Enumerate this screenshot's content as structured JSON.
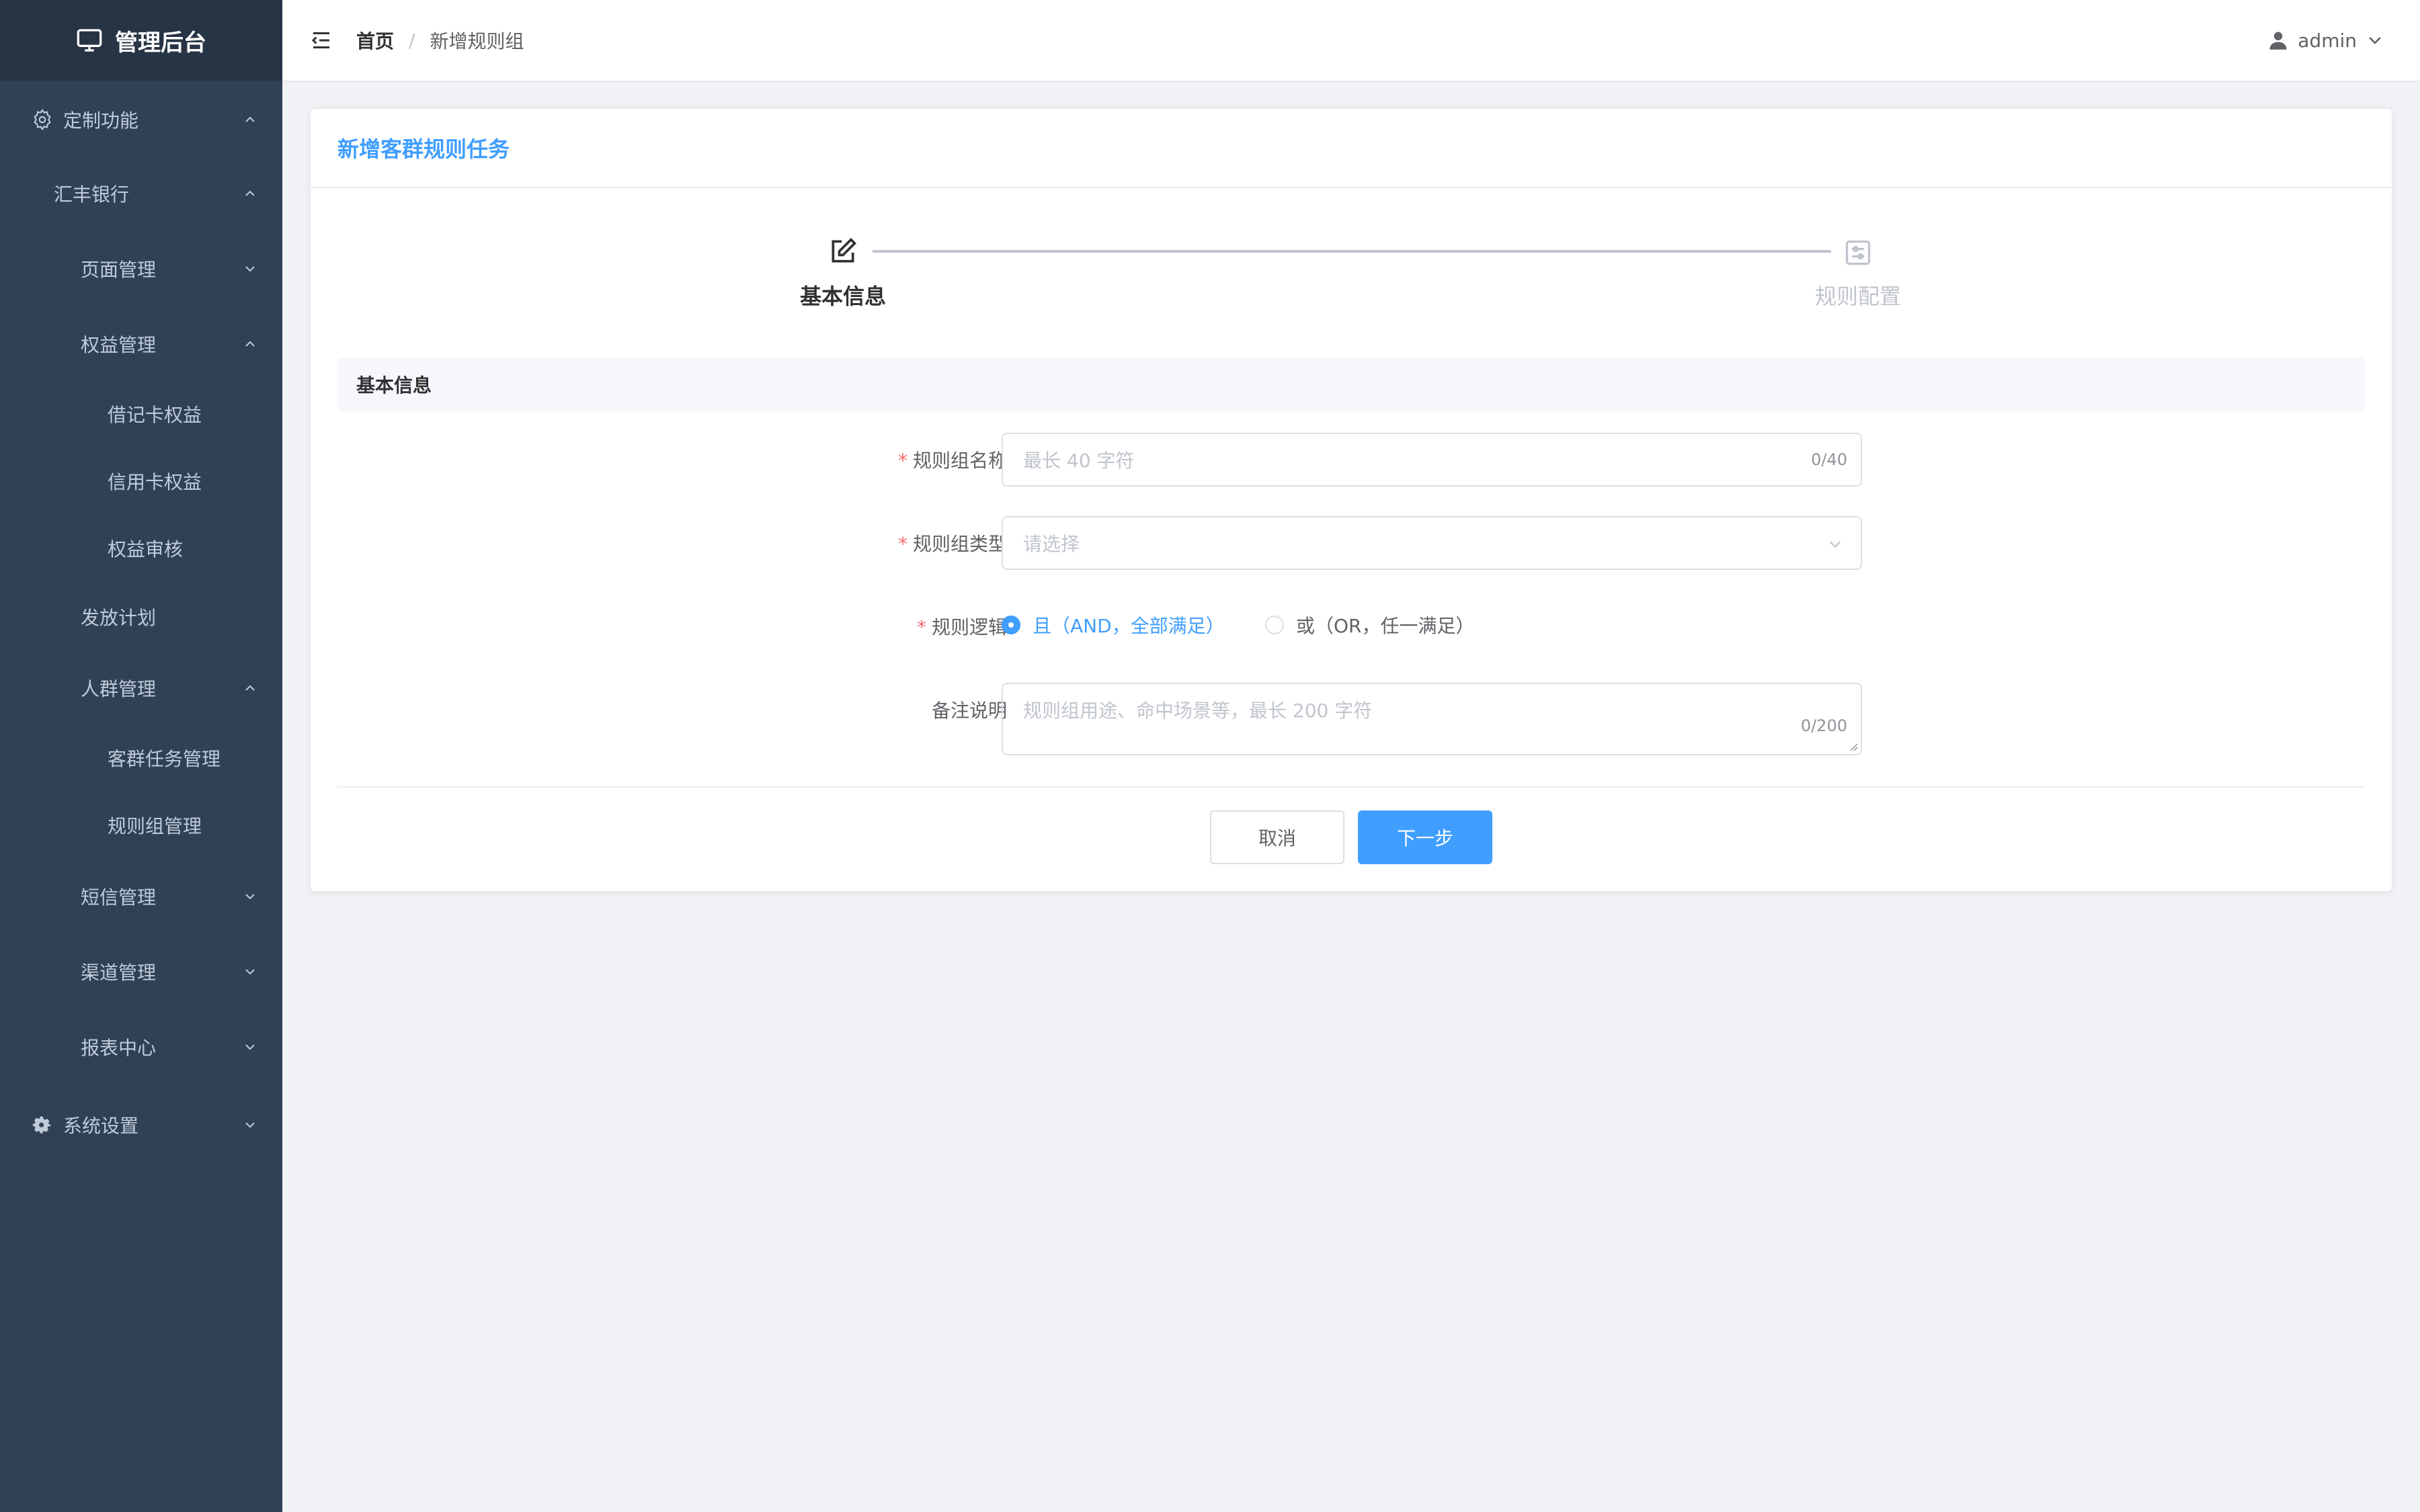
{
  "app": {
    "title": "管理后台"
  },
  "colors": {
    "sidebar_bg": "#304156",
    "sidebar_text": "#bfcbd9",
    "primary": "#409eff",
    "danger": "#f56c6c"
  },
  "sidebar": {
    "items": [
      {
        "label": "定制功能",
        "icon": "gear-outline-icon",
        "arrow": "chevron-up-icon"
      },
      {
        "label": "汇丰银行",
        "arrow": "chevron-up-icon"
      },
      {
        "label": "页面管理",
        "arrow": "chevron-down-icon"
      },
      {
        "label": "权益管理",
        "arrow": "chevron-up-icon"
      },
      {
        "label": "借记卡权益"
      },
      {
        "label": "信用卡权益"
      },
      {
        "label": "权益审核"
      },
      {
        "label": "发放计划"
      },
      {
        "label": "人群管理",
        "arrow": "chevron-up-icon"
      },
      {
        "label": "客群任务管理"
      },
      {
        "label": "规则组管理"
      },
      {
        "label": "短信管理",
        "arrow": "chevron-down-icon"
      },
      {
        "label": "渠道管理",
        "arrow": "chevron-down-icon"
      },
      {
        "label": "报表中心",
        "arrow": "chevron-down-icon"
      },
      {
        "label": "系统设置",
        "icon": "gear-icon",
        "arrow": "chevron-down-icon"
      }
    ]
  },
  "header": {
    "breadcrumb": {
      "home": "首页",
      "separator": "/",
      "current": "新增规则组"
    },
    "user": {
      "name": "admin"
    }
  },
  "card": {
    "title": "新增客群规则任务",
    "steps": [
      {
        "title": "基本信息",
        "icon": "edit-icon",
        "active": true
      },
      {
        "title": "规则配置",
        "icon": "config-icon",
        "active": false
      }
    ],
    "section_title": "基本信息",
    "form": {
      "name": {
        "label": "规则组名称",
        "required": true,
        "placeholder": "最长 40 字符",
        "count": "0/40"
      },
      "type": {
        "label": "规则组类型",
        "required": true,
        "placeholder": "请选择"
      },
      "logic": {
        "label": "规则逻辑",
        "required": true,
        "options": [
          {
            "label": "且（AND，全部满足）",
            "checked": true
          },
          {
            "label": "或（OR，任一满足）",
            "checked": false
          }
        ]
      },
      "remark": {
        "label": "备注说明",
        "required": false,
        "placeholder": "规则组用途、命中场景等，最长 200 字符",
        "count": "0/200"
      }
    },
    "buttons": {
      "cancel": "取消",
      "next": "下一步"
    }
  }
}
